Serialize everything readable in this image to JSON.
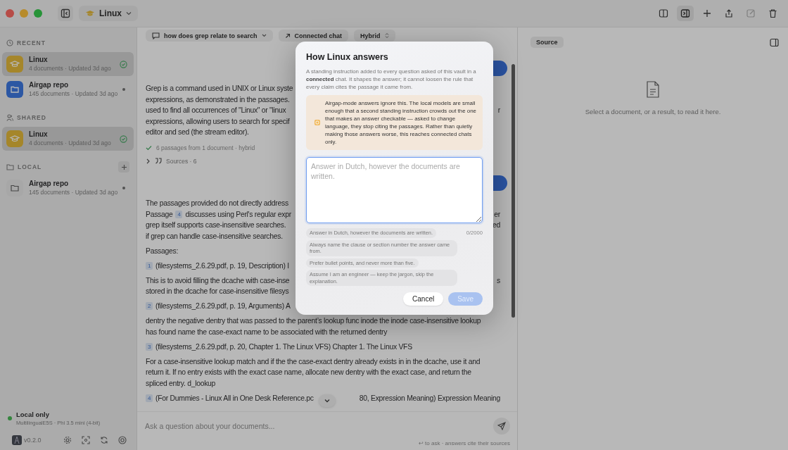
{
  "titlebar": {
    "vault": "Linux"
  },
  "sidebar": {
    "sections": [
      {
        "title": "RECENT",
        "add": false,
        "items": [
          {
            "kind": "course",
            "name": "Linux",
            "detail": "4 documents · Updated 3d ago",
            "selected": true,
            "synced": true
          },
          {
            "kind": "repo",
            "name": "Airgap repo",
            "detail": "145 documents · Updated 3d ago",
            "selected": false,
            "synced": false
          }
        ]
      },
      {
        "title": "SHARED",
        "add": false,
        "items": [
          {
            "kind": "course",
            "name": "Linux",
            "detail": "4 documents · Updated 3d ago",
            "selected": true,
            "synced": true
          }
        ]
      },
      {
        "title": "LOCAL",
        "add": true,
        "items": [
          {
            "kind": "local",
            "name": "Airgap repo",
            "detail": "145 documents · Updated 3d ago",
            "selected": false,
            "synced": false
          }
        ]
      }
    ],
    "status": {
      "label": "Local only",
      "detail": "MultilingualE5S · Phi 3.5 mini (4-bit)",
      "online": true
    },
    "version": "v0.2.0"
  },
  "chat": {
    "conversation": "how does grep relate to search",
    "mode": "Connected chat",
    "retrieval": "Hybrid",
    "answers": [
      {
        "paragraphs": [
          [
            {
              "parts": [
                {
                  "kind": "text",
                  "text": "Grep is a command used in UNIX or Linux syste"
                }
              ]
            },
            {
              "parts": [
                {
                  "kind": "text",
                  "text": "expressions, as demonstrated in the passages."
                }
              ]
            },
            {
              "parts": [
                {
                  "kind": "text",
                  "text": "used to find all occurrences of \"Linux\" or \"linux"
                }
              ],
              "tail": "r"
            },
            {
              "parts": [
                {
                  "kind": "text",
                  "text": "expressions, allowing users to search for specif"
                }
              ]
            },
            {
              "parts": [
                {
                  "kind": "text",
                  "text": "editor and sed (the stream editor)."
                }
              ]
            }
          ]
        ],
        "status": "6 passages from 1 document · hybrid",
        "sources": {
          "label": "Sources",
          "count": "· 6",
          "expanded": false
        }
      },
      {
        "paragraphs": [
          [
            {
              "parts": [
                {
                  "kind": "text",
                  "text": "The passages provided do not directly address"
                }
              ]
            },
            {
              "parts": [
                {
                  "kind": "text",
                  "text": "Passage"
                },
                {
                  "kind": "cite",
                  "text": "4"
                },
                {
                  "kind": "text",
                  "text": "discusses using Perl's regular expr"
                }
              ],
              "tail": "er"
            },
            {
              "parts": [
                {
                  "kind": "text",
                  "text": "grep itself supports case-insensitive searches."
                }
              ],
              "tail": "ed"
            },
            {
              "parts": [
                {
                  "kind": "text",
                  "text": "if grep can handle case-insensitive searches."
                }
              ]
            }
          ],
          [
            {
              "parts": [
                {
                  "kind": "text",
                  "text": "Passages:"
                }
              ]
            }
          ],
          [
            {
              "parts": [
                {
                  "kind": "cite",
                  "text": "1"
                },
                {
                  "kind": "text",
                  "text": "(filesystems_2.6.29.pdf, p. 19, Description) I"
                }
              ]
            }
          ],
          [
            {
              "parts": [
                {
                  "kind": "text",
                  "text": "This is to avoid filling the dcache with case-inse"
                }
              ],
              "tail": "s"
            },
            {
              "parts": [
                {
                  "kind": "text",
                  "text": "stored in the dcache for case-insensitive filesys"
                }
              ]
            }
          ],
          [
            {
              "parts": [
                {
                  "kind": "cite",
                  "text": "2"
                },
                {
                  "kind": "text",
                  "text": "(filesystems_2.6.29.pdf, p. 19, Arguments) A"
                }
              ]
            }
          ],
          [
            {
              "parts": [
                {
                  "kind": "text",
                  "text": "dentry the negative dentry that was passed to the parent’s lookup func inode the inode case-insensitive lookup"
                }
              ]
            },
            {
              "parts": [
                {
                  "kind": "text",
                  "text": "has found name the case-exact name to be associated with the returned dentry"
                }
              ]
            }
          ],
          [
            {
              "parts": [
                {
                  "kind": "cite",
                  "text": "3"
                },
                {
                  "kind": "text",
                  "text": "(filesystems_2.6.29.pdf, p. 20, Chapter 1. The Linux VFS) Chapter 1. The Linux VFS"
                }
              ]
            }
          ],
          [
            {
              "parts": [
                {
                  "kind": "text",
                  "text": "For a case-insensitive lookup match and if the the case-exact dentry already exists in in the dcache, use it and"
                }
              ]
            },
            {
              "parts": [
                {
                  "kind": "text",
                  "text": "return it. If no entry exists with the exact case name, allocate new dentry with the exact case, and return the"
                }
              ]
            },
            {
              "parts": [
                {
                  "kind": "text",
                  "text": "spliced entry. d_lookup"
                }
              ]
            }
          ],
          [
            {
              "parts": [
                {
                  "kind": "cite",
                  "text": "4"
                },
                {
                  "kind": "text",
                  "text": "(For Dummies - Linux All in One Desk Reference.pc"
                }
              ],
              "tail": "80, Expression Meaning) Expression Meaning"
            }
          ]
        ]
      }
    ],
    "input": {
      "placeholder": "Ask a question about your documents..."
    },
    "hint": "↩ to ask · answers cite their sources"
  },
  "source_panel": {
    "tab": "Source",
    "empty_text": "Select a document, or a result, to read it here."
  },
  "dialog": {
    "title": "How Linux answers",
    "description": "A standing instruction added to every question asked of this vault in a **connected** chat. It shapes the answer; it cannot loosen the rule that every claim cites the passage it came from.",
    "warning": "Airgap-mode answers ignore this. The local models are small enough that a second standing instruction crowds out the one that makes an answer checkable — asked to change language, they stop citing the passages. Rather than quietly making those answers worse, this reaches connected chats only.",
    "placeholder": "Answer in Dutch, however the documents are written.",
    "counter": "0/2000",
    "suggestions": [
      "Answer in Dutch, however the documents are written.",
      "Always name the clause or section number the answer came from.",
      "Prefer bullet points, and never more than five.",
      "Assume I am an engineer — keep the jargon, skip the explanation."
    ],
    "cancel": "Cancel",
    "save": {
      "label": "Save",
      "disabled": true
    }
  }
}
